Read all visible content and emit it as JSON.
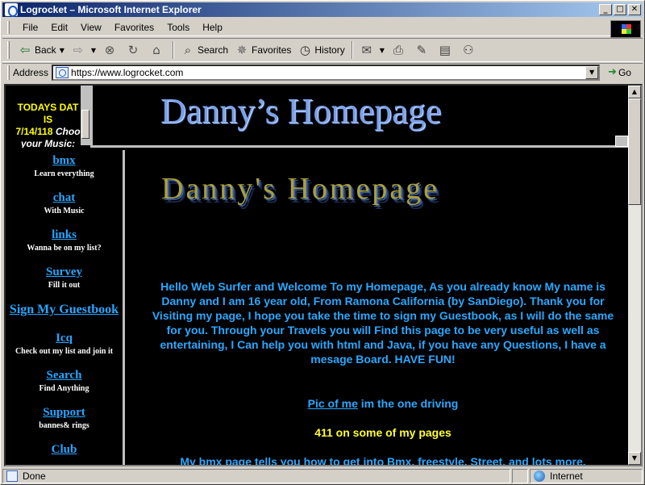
{
  "window": {
    "title": "Logrocket – Microsoft Internet Explorer",
    "minimize": "_",
    "maximize": "□",
    "close": "✕"
  },
  "menu": [
    "File",
    "Edit",
    "View",
    "Favorites",
    "Tools",
    "Help"
  ],
  "toolbar": {
    "back": "Back",
    "search": "Search",
    "favorites": "Favorites",
    "history": "History"
  },
  "address": {
    "label": "Address",
    "url": "https://www.logrocket.com",
    "go": "Go"
  },
  "date_frame": {
    "line1": "TODAYS DAT",
    "line2": "IS",
    "line3": "7/14/118",
    "line3_suffix": "Choo",
    "line4": "your Music:"
  },
  "banner": {
    "title": "Danny’s Homepage"
  },
  "nav": [
    {
      "label": "bmx",
      "sub": "Learn everything"
    },
    {
      "label": "chat",
      "sub": "With Music"
    },
    {
      "label": "links",
      "sub": "Wanna be on my list?"
    },
    {
      "label": "Survey",
      "sub": "Fill it out"
    },
    {
      "label": "Sign My Guestbook",
      "sub": ""
    },
    {
      "label": "Icq",
      "sub": "Check out my list and join it"
    },
    {
      "label": "Search",
      "sub": "Find Anything"
    },
    {
      "label": "Support",
      "sub": "bannes& rings"
    },
    {
      "label": "Club",
      "sub": ""
    }
  ],
  "main": {
    "title": "Danny's Homepage",
    "intro": "Hello Web Surfer and Welcome To my Homepage, As you already know My name is Danny and I am 16 year old, From Ramona California (by SanDiego). Thank you for Visiting my page, I hope you take the time to sign my Guestbook, as I will do the same for you. Through your Travels you will Find this page to be very useful as well as entertaining, I Can help you with html and Java, if you have any Questions, I have a mesage Board. HAVE FUN!",
    "pic_link": "Pic of me",
    "pic_suffix": " im the one driving",
    "info411": "411 on some of my pages",
    "bmx_line": "My bmx page tells you how to get into Bmx, freestyle, Street, and lots more."
  },
  "status": {
    "left": "Done",
    "zone": "Internet"
  },
  "colors": {
    "link": "#27a6ff",
    "highlight": "#ffff30",
    "title_bar": "#0a246a"
  }
}
